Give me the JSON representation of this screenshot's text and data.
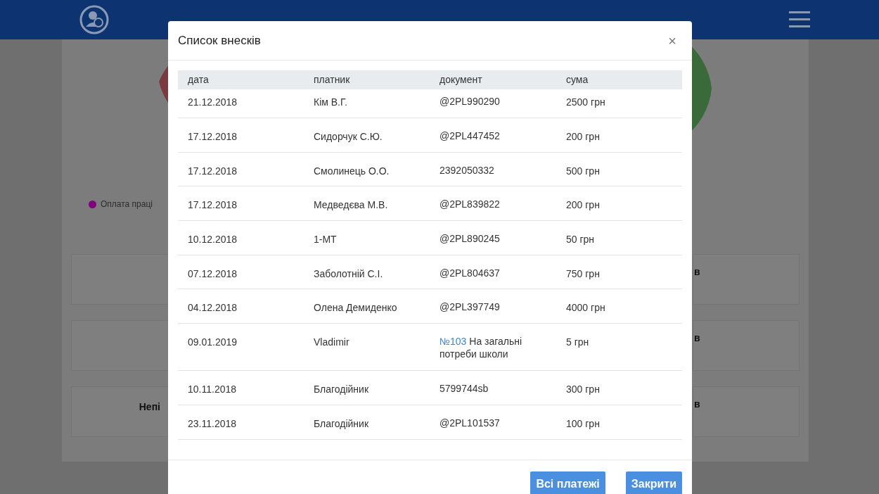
{
  "background": {
    "legend": [
      {
        "label": "Оплата праці",
        "color": "#800080"
      }
    ],
    "cards_left": [
      {
        "kind": "blank"
      },
      {
        "kind": "blank"
      },
      {
        "kind": "titled",
        "heading": "Непі"
      }
    ],
    "cards_right": [
      "в",
      "в",
      "в"
    ]
  },
  "modal": {
    "title": "Список внесків",
    "close": "×",
    "columns": [
      "дата",
      "платник",
      "документ",
      "сума"
    ],
    "rows": [
      {
        "date": "21.12.2018",
        "payer": "Кім В.Г.",
        "document": "@2PL990290",
        "amount": "2500 грн"
      },
      {
        "date": "17.12.2018",
        "payer": "Сидорчук С.Ю.",
        "document": "@2PL447452",
        "amount": "200 грн"
      },
      {
        "date": "17.12.2018",
        "payer": "Смолинець О.О.",
        "document": "2392050332",
        "amount": "500 грн"
      },
      {
        "date": "17.12.2018",
        "payer": "Медведєва М.В.",
        "document": "@2PL839822",
        "amount": "200 грн"
      },
      {
        "date": "10.12.2018",
        "payer": "1-МТ",
        "document": "@2PL890245",
        "amount": "50 грн"
      },
      {
        "date": "07.12.2018",
        "payer": "Заболотній С.І.",
        "document": "@2PL804637",
        "amount": "750 грн"
      },
      {
        "date": "04.12.2018",
        "payer": "Олена Демиденко",
        "document": "@2PL397749",
        "amount": "4000 грн"
      },
      {
        "date": "09.01.2019",
        "payer": "Vladimir",
        "document_link": "№103",
        "document": "На загальні потреби школи",
        "amount": "5 грн"
      },
      {
        "date": "10.11.2018",
        "payer": "Благодійник",
        "document": "5799744sb",
        "amount": "300 грн"
      },
      {
        "date": "23.11.2018",
        "payer": "Благодійник",
        "document": "@2PL101537",
        "amount": "100 грн"
      }
    ],
    "buttons": [
      "Всі платежі",
      "Закрити"
    ]
  }
}
